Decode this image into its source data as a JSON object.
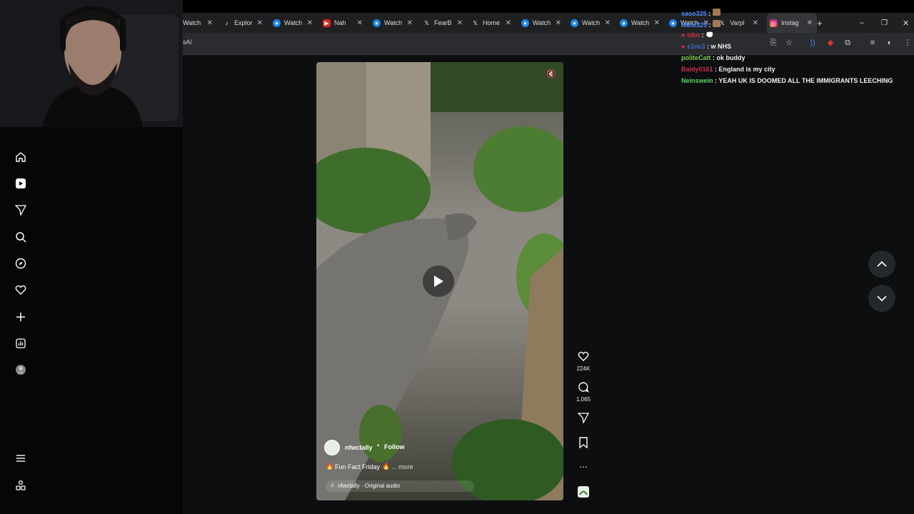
{
  "browser": {
    "tabs": [
      {
        "label": "Watch",
        "icon": "globe-icon"
      },
      {
        "label": "Explor",
        "icon": "tiktok-icon"
      },
      {
        "label": "Watch",
        "icon": "globe-icon"
      },
      {
        "label": "Nah",
        "icon": "youtube-icon"
      },
      {
        "label": "Watch",
        "icon": "globe-icon"
      },
      {
        "label": "FearB",
        "icon": "x-icon"
      },
      {
        "label": "Home",
        "icon": "x-icon"
      },
      {
        "label": "Watch",
        "icon": "globe-icon"
      },
      {
        "label": "Watch",
        "icon": "globe-icon"
      },
      {
        "label": "Watch",
        "icon": "globe-icon"
      },
      {
        "label": "Watch",
        "icon": "globe-icon"
      },
      {
        "label": "Varpl",
        "icon": "x-icon"
      },
      {
        "label": "Instag",
        "icon": "instagram-icon"
      }
    ],
    "url": "sA/"
  },
  "post": {
    "username": "nfwctally",
    "follow_label": "Follow",
    "caption": "Fun Fact Friday",
    "more_label": "... more",
    "audio": "nfwctally · Original audio",
    "likes": "224K",
    "comments": "1,065"
  },
  "chat": [
    {
      "user": "saso325",
      "message": "",
      "color": "#4a8cff"
    },
    {
      "user": "Mato325",
      "message": "",
      "color": "#4a8cff"
    },
    {
      "user": "siko",
      "message": "",
      "color": "#d0303a"
    },
    {
      "user": "s1nc3",
      "message": "w NHS",
      "color": "#3a6bd8"
    },
    {
      "user": "politeCatt",
      "message": "ok buddy",
      "color": "#7fd35a"
    },
    {
      "user": "Baldy0161",
      "message": "England is my city",
      "color": "#c8304a"
    },
    {
      "user": "Neinswein",
      "message": "YEAH UK IS DOOMED ALL THE IMMIGRANTS LEECHING",
      "color": "#5ed65e"
    }
  ],
  "colors": {
    "accent": "#0095f6",
    "background": "#0c0e10"
  }
}
